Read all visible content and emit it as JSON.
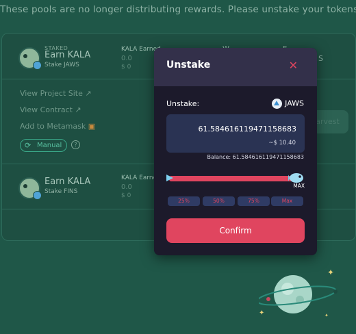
{
  "banner": {
    "text": "These pools are no longer distributing rewards. Please unstake your tokens."
  },
  "farms": [
    {
      "staked_tag": "STAKED",
      "earn_title": "Earn KALA",
      "stake_label": "Stake JAWS",
      "earned_label": "KALA Earned",
      "earned_value": "0.0",
      "earned_usd": "$ 0"
    },
    {
      "earn_title": "Earn KALA",
      "stake_label": "Stake FINS",
      "earned_label": "KALA Earned",
      "earned_value": "0.0",
      "earned_usd": "$ 0"
    }
  ],
  "details": {
    "view_project_site": "View Project Site",
    "view_contract": "View Contract",
    "add_to_metamask": "Add to Metamask",
    "manual_label": "Manual",
    "harvest_label": "Harvest"
  },
  "modal": {
    "title": "Unstake",
    "unstake_label": "Unstake:",
    "token_name": "JAWS",
    "amount_value": "61.584616119471158683",
    "usd_value": "~$ 10.40",
    "balance_text": "Balance: 61.584616119471158683",
    "max_label": "MAX",
    "slider_percent": 100,
    "percent_buttons": [
      "25%",
      "50%",
      "75%",
      "Max"
    ],
    "confirm_label": "Confirm"
  },
  "colors": {
    "accent": "#e0455f",
    "background": "#1f5748",
    "modal_bg": "#1c1a2b",
    "input_bg": "#2a3353"
  },
  "icons": {
    "external_link": "external-link-icon",
    "metamask": "metamask-icon",
    "refresh": "refresh-icon",
    "help": "help-icon",
    "close": "close-icon",
    "token": "jaws-token-icon"
  }
}
